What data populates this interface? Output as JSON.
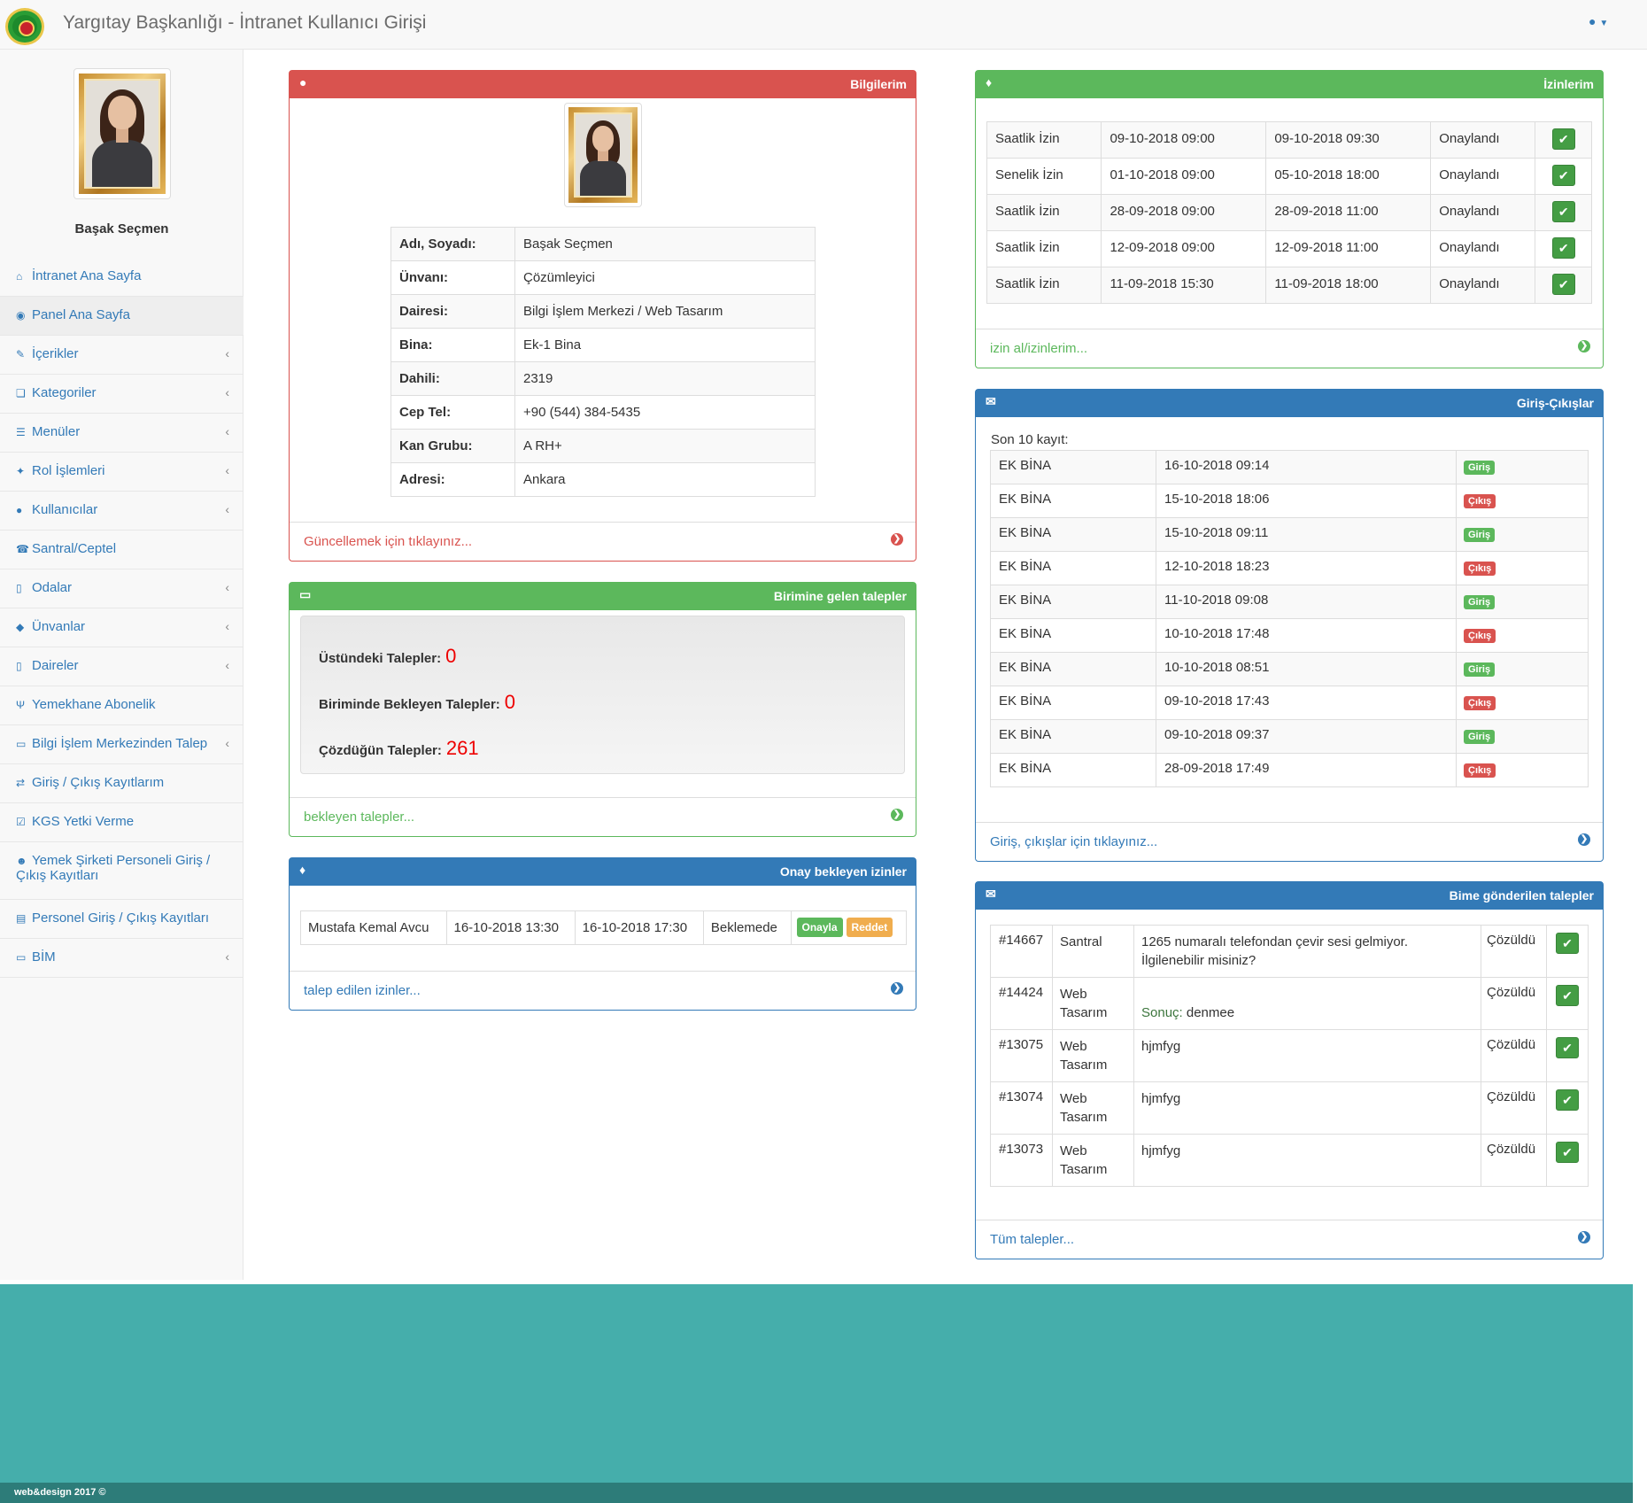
{
  "header": {
    "title": "Yargıtay Başkanlığı - İntranet Kullanıcı Girişi",
    "user_icon": "user-icon"
  },
  "sidebar": {
    "user_name": "Başak Seçmen",
    "items": [
      {
        "label": "İntranet Ana Sayfa",
        "icon": "⌂",
        "sub": false
      },
      {
        "label": "Panel Ana Sayfa",
        "icon": "◉",
        "sub": false
      },
      {
        "label": "İçerikler",
        "icon": "✎",
        "sub": true
      },
      {
        "label": "Kategoriler",
        "icon": "❏",
        "sub": true
      },
      {
        "label": "Menüler",
        "icon": "☰",
        "sub": true
      },
      {
        "label": "Rol İşlemleri",
        "icon": "✦",
        "sub": true
      },
      {
        "label": "Kullanıcılar",
        "icon": "●",
        "sub": true
      },
      {
        "label": "Santral/Ceptel",
        "icon": "☎",
        "sub": false
      },
      {
        "label": "Odalar",
        "icon": "▯",
        "sub": true
      },
      {
        "label": "Ünvanlar",
        "icon": "◆",
        "sub": true
      },
      {
        "label": "Daireler",
        "icon": "▯",
        "sub": true
      },
      {
        "label": "Yemekhane Abonelik",
        "icon": "Ψ",
        "sub": false
      },
      {
        "label": "Bilgi İşlem Merkezinden Talep",
        "icon": "▭",
        "sub": true
      },
      {
        "label": "Giriş / Çıkış Kayıtlarım",
        "icon": "⇄",
        "sub": false
      },
      {
        "label": "KGS Yetki Verme",
        "icon": "☑",
        "sub": false
      },
      {
        "label": "Yemek Şirketi Personeli Giriş / Çıkış Kayıtları",
        "icon": "☻",
        "sub": false
      },
      {
        "label": "Personel Giriş / Çıkış Kayıtları",
        "icon": "▤",
        "sub": false
      },
      {
        "label": "BİM",
        "icon": "▭",
        "sub": true
      }
    ]
  },
  "bilgilerim": {
    "title": "Bilgilerim",
    "rows": [
      {
        "label": "Adı, Soyadı:",
        "value": "Başak Seçmen"
      },
      {
        "label": "Ünvanı:",
        "value": "Çözümleyici"
      },
      {
        "label": "Dairesi:",
        "value": "Bilgi İşlem Merkezi / Web Tasarım"
      },
      {
        "label": "Bina:",
        "value": "Ek-1 Bina"
      },
      {
        "label": "Dahili:",
        "value": "2319"
      },
      {
        "label": "Cep Tel:",
        "value": "+90 (544) 384-5435"
      },
      {
        "label": "Kan Grubu:",
        "value": "A RH+"
      },
      {
        "label": "Adresi:",
        "value": "Ankara"
      }
    ],
    "footer": "Güncellemek için tıklayınız..."
  },
  "birimine": {
    "title": "Birimine gelen talepler",
    "stats": [
      {
        "label": "Üstündeki Talepler:",
        "value": "0"
      },
      {
        "label": "Biriminde Bekleyen Talepler:",
        "value": "0"
      },
      {
        "label": "Çözdüğün Talepler:",
        "value": "261"
      }
    ],
    "footer": "bekleyen talepler..."
  },
  "onay": {
    "title": "Onay bekleyen izinler",
    "rows": [
      {
        "name": "Mustafa Kemal Avcu",
        "start": "16-10-2018 13:30",
        "end": "16-10-2018 17:30",
        "status": "Beklemede",
        "approve": "Onayla",
        "reject": "Reddet"
      }
    ],
    "footer": "talep edilen izinler..."
  },
  "izinlerim": {
    "title": "İzinlerim",
    "rows": [
      {
        "type": "Saatlik İzin",
        "start": "09-10-2018 09:00",
        "end": "09-10-2018 09:30",
        "status": "Onaylandı"
      },
      {
        "type": "Senelik İzin",
        "start": "01-10-2018 09:00",
        "end": "05-10-2018 18:00",
        "status": "Onaylandı"
      },
      {
        "type": "Saatlik İzin",
        "start": "28-09-2018 09:00",
        "end": "28-09-2018 11:00",
        "status": "Onaylandı"
      },
      {
        "type": "Saatlik İzin",
        "start": "12-09-2018 09:00",
        "end": "12-09-2018 11:00",
        "status": "Onaylandı"
      },
      {
        "type": "Saatlik İzin",
        "start": "11-09-2018 15:30",
        "end": "11-09-2018 18:00",
        "status": "Onaylandı"
      }
    ],
    "footer": "izin al/izinlerim..."
  },
  "giris_cikislar": {
    "title": "Giriş-Çıkışlar",
    "subtitle": "Son 10 kayıt:",
    "rows": [
      {
        "place": "EK BİNA",
        "time": "16-10-2018 09:14",
        "kind": "Giriş"
      },
      {
        "place": "EK BİNA",
        "time": "15-10-2018 18:06",
        "kind": "Çıkış"
      },
      {
        "place": "EK BİNA",
        "time": "15-10-2018 09:11",
        "kind": "Giriş"
      },
      {
        "place": "EK BİNA",
        "time": "12-10-2018 18:23",
        "kind": "Çıkış"
      },
      {
        "place": "EK BİNA",
        "time": "11-10-2018 09:08",
        "kind": "Giriş"
      },
      {
        "place": "EK BİNA",
        "time": "10-10-2018 17:48",
        "kind": "Çıkış"
      },
      {
        "place": "EK BİNA",
        "time": "10-10-2018 08:51",
        "kind": "Giriş"
      },
      {
        "place": "EK BİNA",
        "time": "09-10-2018 17:43",
        "kind": "Çıkış"
      },
      {
        "place": "EK BİNA",
        "time": "09-10-2018 09:37",
        "kind": "Giriş"
      },
      {
        "place": "EK BİNA",
        "time": "28-09-2018 17:49",
        "kind": "Çıkış"
      }
    ],
    "footer": "Giriş, çıkışlar için tıklayınız..."
  },
  "bime": {
    "title": "Bime gönderilen talepler",
    "rows": [
      {
        "id": "#14667",
        "unit": "Santral",
        "desc": "1265 numaralı telefondan çevir sesi gelmiyor. İlgilenebilir misiniz?",
        "result_label": "",
        "result": "",
        "status": "Çözüldü"
      },
      {
        "id": "#14424",
        "unit": "Web Tasarım",
        "desc": "",
        "result_label": "Sonuç:",
        "result": "denmee",
        "status": "Çözüldü"
      },
      {
        "id": "#13075",
        "unit": "Web Tasarım",
        "desc": "hjmfyg",
        "result_label": "",
        "result": "",
        "status": "Çözüldü"
      },
      {
        "id": "#13074",
        "unit": "Web Tasarım",
        "desc": "hjmfyg",
        "result_label": "",
        "result": "",
        "status": "Çözüldü"
      },
      {
        "id": "#13073",
        "unit": "Web Tasarım",
        "desc": "hjmfyg",
        "result_label": "",
        "result": "",
        "status": "Çözüldü"
      }
    ],
    "footer": "Tüm talepler..."
  },
  "footer": {
    "text": "web&design 2017 ©"
  },
  "colors": {
    "red": "#d9534f",
    "green": "#5cb85c",
    "blue": "#337ab7",
    "teal": "#45aeab",
    "orange": "#f0ad4e"
  }
}
